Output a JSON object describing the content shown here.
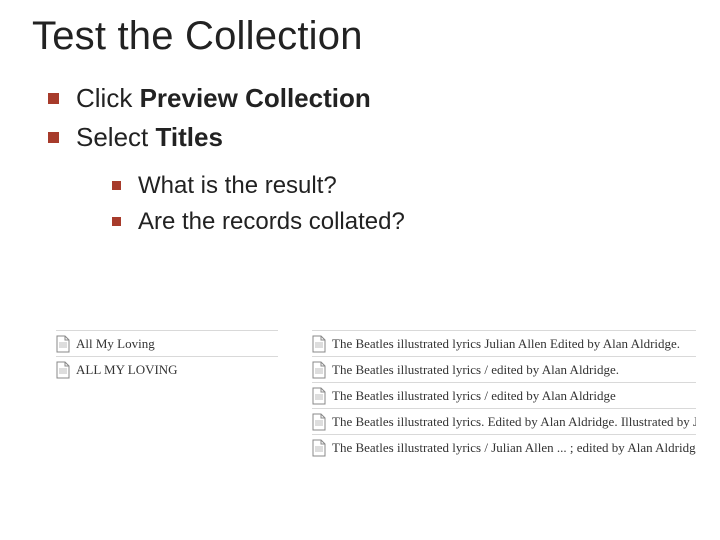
{
  "title": "Test the Collection",
  "bullets": {
    "b1_pre": "Click ",
    "b1_bold": "Preview Collection",
    "b2_pre": "Select ",
    "b2_bold": "Titles",
    "sub1": "What is the result?",
    "sub2": "Are the records collated?"
  },
  "results_left": [
    "All My Loving",
    "ALL MY LOVING"
  ],
  "results_right": [
    "The Beatles illustrated lyrics Julian Allen Edited by Alan Aldridge.",
    "The Beatles illustrated lyrics / edited by Alan Aldridge.",
    "The Beatles illustrated lyrics / edited by Alan Aldridge",
    "The Beatles illustrated lyrics. Edited by Alan Aldridge. Illustrated by Julian Allen",
    "The Beatles illustrated lyrics / Julian Allen ... ; edited by Alan Aldridge."
  ]
}
